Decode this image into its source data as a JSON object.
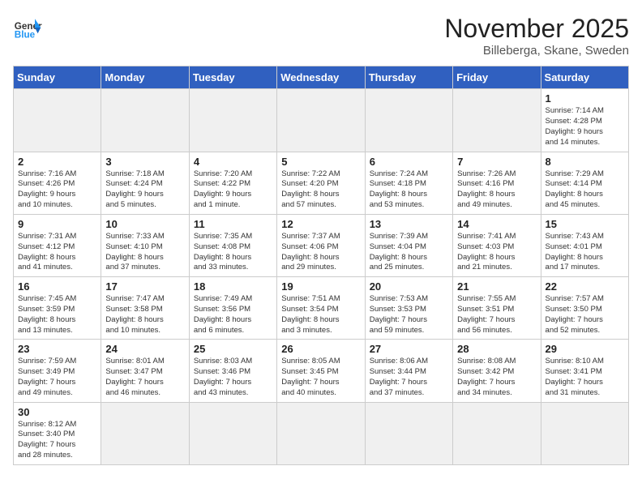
{
  "header": {
    "logo_general": "General",
    "logo_blue": "Blue",
    "month_title": "November 2025",
    "location": "Billeberga, Skane, Sweden"
  },
  "weekdays": [
    "Sunday",
    "Monday",
    "Tuesday",
    "Wednesday",
    "Thursday",
    "Friday",
    "Saturday"
  ],
  "weeks": [
    [
      {
        "day": "",
        "text": ""
      },
      {
        "day": "",
        "text": ""
      },
      {
        "day": "",
        "text": ""
      },
      {
        "day": "",
        "text": ""
      },
      {
        "day": "",
        "text": ""
      },
      {
        "day": "",
        "text": ""
      },
      {
        "day": "1",
        "text": "Sunrise: 7:14 AM\nSunset: 4:28 PM\nDaylight: 9 hours\nand 14 minutes."
      }
    ],
    [
      {
        "day": "2",
        "text": "Sunrise: 7:16 AM\nSunset: 4:26 PM\nDaylight: 9 hours\nand 10 minutes."
      },
      {
        "day": "3",
        "text": "Sunrise: 7:18 AM\nSunset: 4:24 PM\nDaylight: 9 hours\nand 5 minutes."
      },
      {
        "day": "4",
        "text": "Sunrise: 7:20 AM\nSunset: 4:22 PM\nDaylight: 9 hours\nand 1 minute."
      },
      {
        "day": "5",
        "text": "Sunrise: 7:22 AM\nSunset: 4:20 PM\nDaylight: 8 hours\nand 57 minutes."
      },
      {
        "day": "6",
        "text": "Sunrise: 7:24 AM\nSunset: 4:18 PM\nDaylight: 8 hours\nand 53 minutes."
      },
      {
        "day": "7",
        "text": "Sunrise: 7:26 AM\nSunset: 4:16 PM\nDaylight: 8 hours\nand 49 minutes."
      },
      {
        "day": "8",
        "text": "Sunrise: 7:29 AM\nSunset: 4:14 PM\nDaylight: 8 hours\nand 45 minutes."
      }
    ],
    [
      {
        "day": "9",
        "text": "Sunrise: 7:31 AM\nSunset: 4:12 PM\nDaylight: 8 hours\nand 41 minutes."
      },
      {
        "day": "10",
        "text": "Sunrise: 7:33 AM\nSunset: 4:10 PM\nDaylight: 8 hours\nand 37 minutes."
      },
      {
        "day": "11",
        "text": "Sunrise: 7:35 AM\nSunset: 4:08 PM\nDaylight: 8 hours\nand 33 minutes."
      },
      {
        "day": "12",
        "text": "Sunrise: 7:37 AM\nSunset: 4:06 PM\nDaylight: 8 hours\nand 29 minutes."
      },
      {
        "day": "13",
        "text": "Sunrise: 7:39 AM\nSunset: 4:04 PM\nDaylight: 8 hours\nand 25 minutes."
      },
      {
        "day": "14",
        "text": "Sunrise: 7:41 AM\nSunset: 4:03 PM\nDaylight: 8 hours\nand 21 minutes."
      },
      {
        "day": "15",
        "text": "Sunrise: 7:43 AM\nSunset: 4:01 PM\nDaylight: 8 hours\nand 17 minutes."
      }
    ],
    [
      {
        "day": "16",
        "text": "Sunrise: 7:45 AM\nSunset: 3:59 PM\nDaylight: 8 hours\nand 13 minutes."
      },
      {
        "day": "17",
        "text": "Sunrise: 7:47 AM\nSunset: 3:58 PM\nDaylight: 8 hours\nand 10 minutes."
      },
      {
        "day": "18",
        "text": "Sunrise: 7:49 AM\nSunset: 3:56 PM\nDaylight: 8 hours\nand 6 minutes."
      },
      {
        "day": "19",
        "text": "Sunrise: 7:51 AM\nSunset: 3:54 PM\nDaylight: 8 hours\nand 3 minutes."
      },
      {
        "day": "20",
        "text": "Sunrise: 7:53 AM\nSunset: 3:53 PM\nDaylight: 7 hours\nand 59 minutes."
      },
      {
        "day": "21",
        "text": "Sunrise: 7:55 AM\nSunset: 3:51 PM\nDaylight: 7 hours\nand 56 minutes."
      },
      {
        "day": "22",
        "text": "Sunrise: 7:57 AM\nSunset: 3:50 PM\nDaylight: 7 hours\nand 52 minutes."
      }
    ],
    [
      {
        "day": "23",
        "text": "Sunrise: 7:59 AM\nSunset: 3:49 PM\nDaylight: 7 hours\nand 49 minutes."
      },
      {
        "day": "24",
        "text": "Sunrise: 8:01 AM\nSunset: 3:47 PM\nDaylight: 7 hours\nand 46 minutes."
      },
      {
        "day": "25",
        "text": "Sunrise: 8:03 AM\nSunset: 3:46 PM\nDaylight: 7 hours\nand 43 minutes."
      },
      {
        "day": "26",
        "text": "Sunrise: 8:05 AM\nSunset: 3:45 PM\nDaylight: 7 hours\nand 40 minutes."
      },
      {
        "day": "27",
        "text": "Sunrise: 8:06 AM\nSunset: 3:44 PM\nDaylight: 7 hours\nand 37 minutes."
      },
      {
        "day": "28",
        "text": "Sunrise: 8:08 AM\nSunset: 3:42 PM\nDaylight: 7 hours\nand 34 minutes."
      },
      {
        "day": "29",
        "text": "Sunrise: 8:10 AM\nSunset: 3:41 PM\nDaylight: 7 hours\nand 31 minutes."
      }
    ],
    [
      {
        "day": "30",
        "text": "Sunrise: 8:12 AM\nSunset: 3:40 PM\nDaylight: 7 hours\nand 28 minutes."
      },
      {
        "day": "",
        "text": ""
      },
      {
        "day": "",
        "text": ""
      },
      {
        "day": "",
        "text": ""
      },
      {
        "day": "",
        "text": ""
      },
      {
        "day": "",
        "text": ""
      },
      {
        "day": "",
        "text": ""
      }
    ]
  ]
}
